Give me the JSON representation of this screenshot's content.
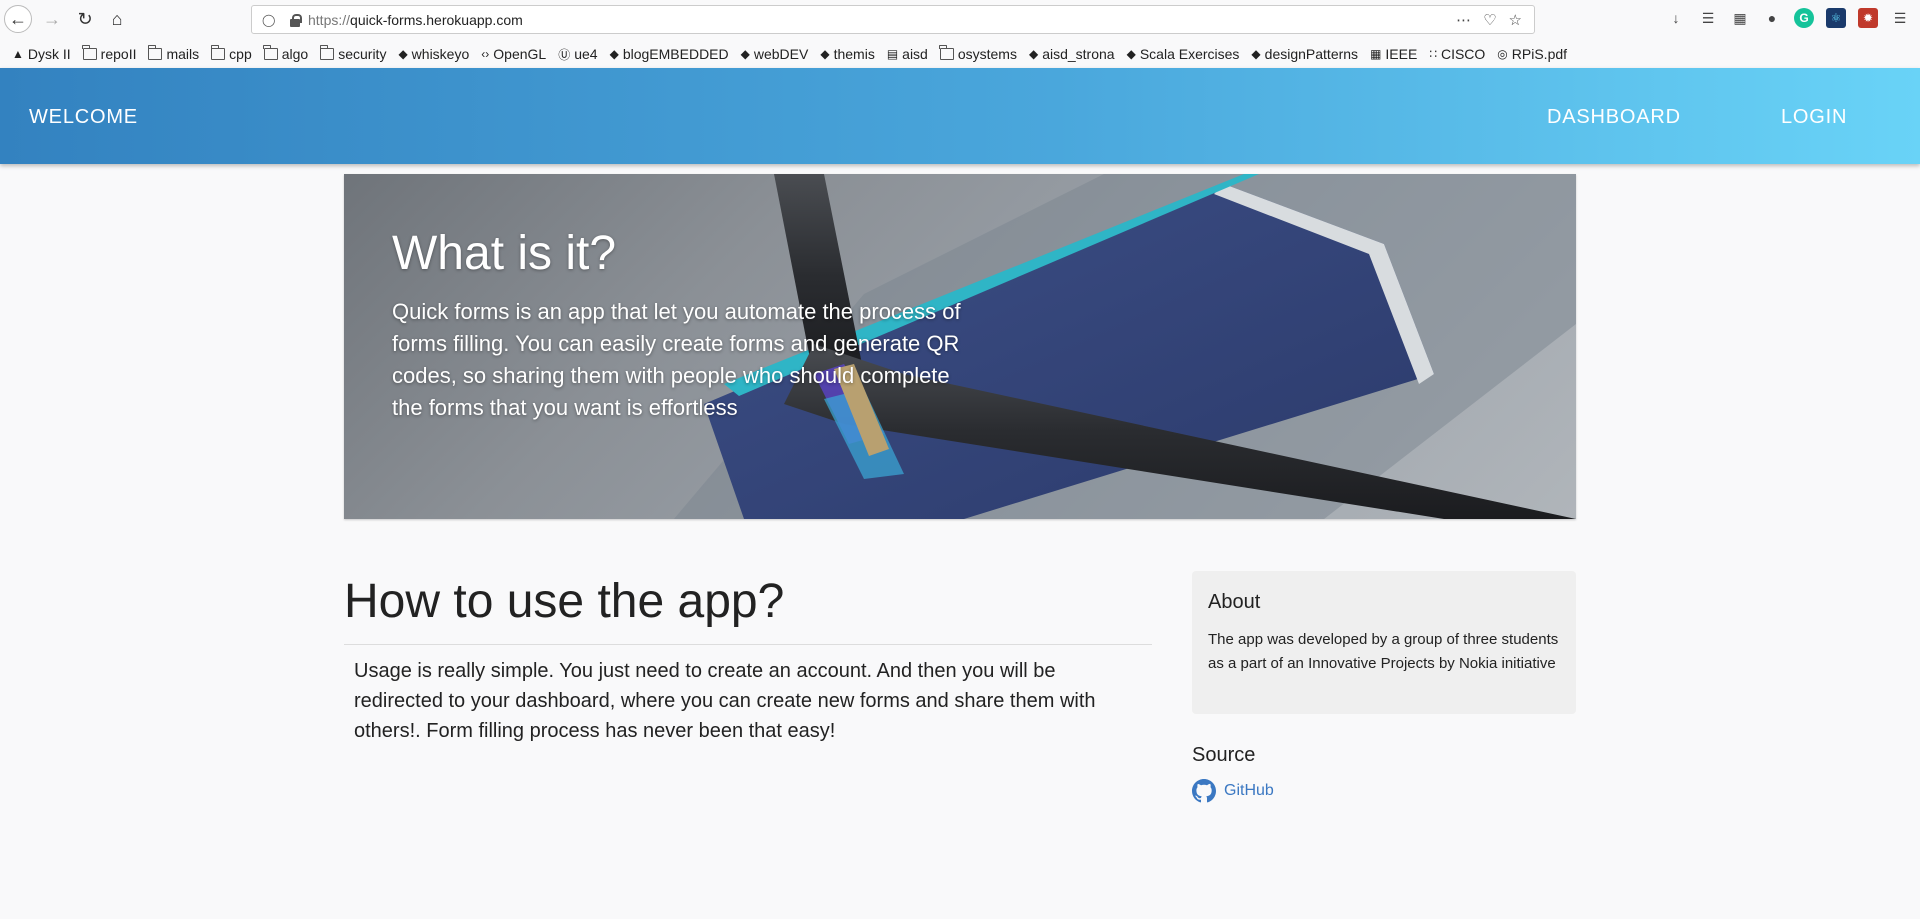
{
  "browser": {
    "url_protocol": "https://",
    "url_host": "quick-forms.herokuapp.com",
    "bookmarks": [
      {
        "label": "Dysk II",
        "icon": "drive-icon"
      },
      {
        "label": "repoII",
        "icon": "folder-icon"
      },
      {
        "label": "mails",
        "icon": "folder-icon"
      },
      {
        "label": "cpp",
        "icon": "folder-icon"
      },
      {
        "label": "algo",
        "icon": "folder-icon"
      },
      {
        "label": "security",
        "icon": "folder-icon"
      },
      {
        "label": "whiskeyo",
        "icon": "site-icon"
      },
      {
        "label": "OpenGL",
        "icon": "code-icon"
      },
      {
        "label": "ue4",
        "icon": "unreal-icon"
      },
      {
        "label": "blogEMBEDDED",
        "icon": "site-icon"
      },
      {
        "label": "webDEV",
        "icon": "site-icon"
      },
      {
        "label": "themis",
        "icon": "site-icon"
      },
      {
        "label": "aisd",
        "icon": "document-icon"
      },
      {
        "label": "osystems",
        "icon": "folder-icon"
      },
      {
        "label": "aisd_strona",
        "icon": "site-icon"
      },
      {
        "label": "Scala Exercises",
        "icon": "site-icon"
      },
      {
        "label": "designPatterns",
        "icon": "site-icon"
      },
      {
        "label": "IEEE",
        "icon": "ieee-icon"
      },
      {
        "label": "CISCO",
        "icon": "cisco-icon"
      },
      {
        "label": "RPiS.pdf",
        "icon": "globe-icon"
      }
    ],
    "extension_glyphs": {
      "grammarly": "G"
    }
  },
  "site": {
    "nav": {
      "welcome": "WELCOME",
      "dashboard": "DASHBOARD",
      "login": "LOGIN"
    },
    "hero": {
      "title": "What is it?",
      "description": "Quick forms is an app that let you automate the process of forms filling. You can easily create forms and generate QR codes, so sharing them with people who should complete the forms that you want is effortless"
    },
    "main": {
      "title": "How to use the app?",
      "text": "Usage is really simple. You just need to create an account. And then you will be redirected to your dashboard, where you can create new forms and share them with others!. Form filling process has never been that easy!"
    },
    "sidebar": {
      "about_title": "About",
      "about_text": "The app was developed by a group of three students as a part of an Innovative Projects by Nokia initiative",
      "source_title": "Source",
      "github_label": "GitHub"
    }
  },
  "colors": {
    "header_start": "#3382c0",
    "header_end": "#69d3f7",
    "link": "#3b78c2"
  }
}
